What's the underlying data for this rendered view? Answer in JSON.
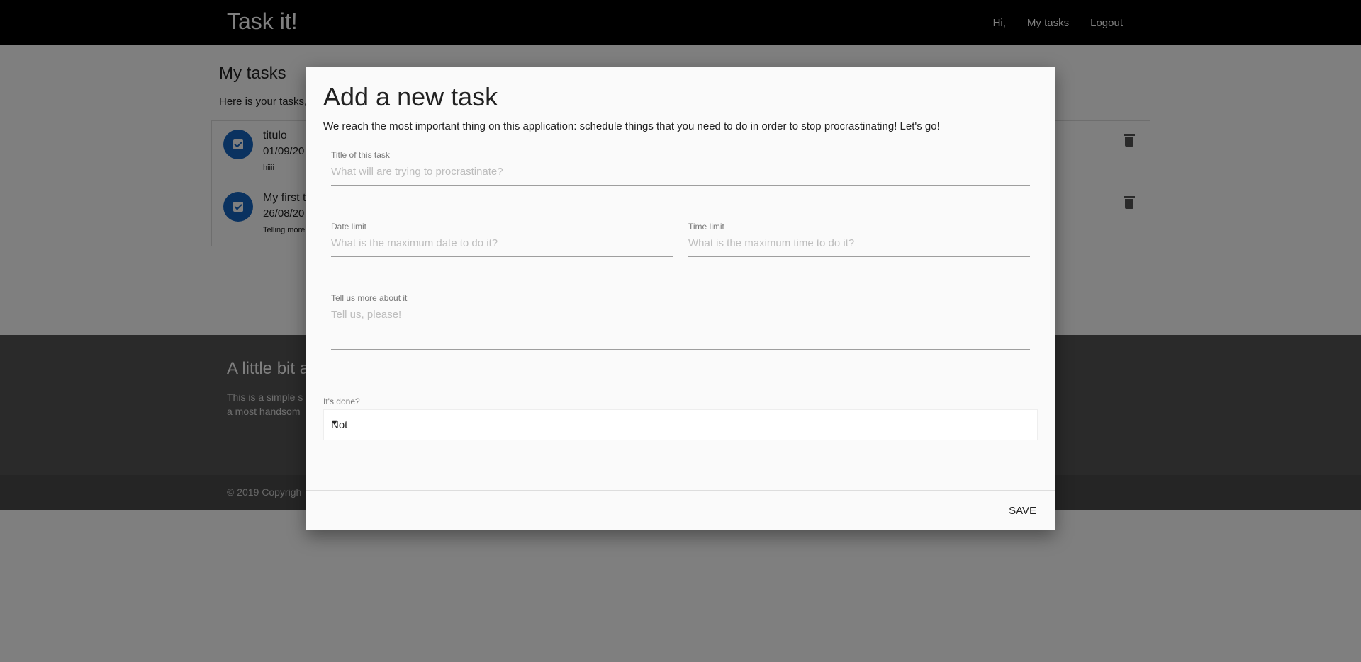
{
  "navbar": {
    "brand": "Task it!",
    "links": [
      "Hi,",
      "My tasks",
      "Logout"
    ]
  },
  "page": {
    "title": "My tasks",
    "subtitle": "Here is your tasks,"
  },
  "tasks": [
    {
      "title": "titulo",
      "date": "01/09/20",
      "description": "hiiii"
    },
    {
      "title": "My first t",
      "date": "26/08/20",
      "description": "Telling more"
    }
  ],
  "footer": {
    "title": "A little bit a",
    "text_line1": "This is a simple s",
    "text_line2": "a most handsom",
    "copyright": "© 2019 Copyrigh"
  },
  "modal": {
    "title": "Add a new task",
    "intro": "We reach the most important thing on this application: schedule things that you need to do in order to stop procrastinating! Let's go!",
    "fields": {
      "title": {
        "label": "Title of this task",
        "placeholder": "What will are trying to procrastinate?",
        "value": ""
      },
      "date": {
        "label": "Date limit",
        "placeholder": "What is the maximum date to do it?",
        "value": ""
      },
      "time": {
        "label": "Time limit",
        "placeholder": "What is the maximum time to do it?",
        "value": ""
      },
      "description": {
        "label": "Tell us more about it",
        "placeholder": "Tell us, please!",
        "value": ""
      }
    },
    "done": {
      "label": "It's done?",
      "selected": "Not"
    },
    "save_label": "SAVE"
  },
  "icons": {
    "check": "check-icon",
    "delete": "trash-icon",
    "caret": "caret-down-icon"
  },
  "colors": {
    "navbar": "#000000",
    "avatar": "#1565c0",
    "footer": "#555555"
  }
}
